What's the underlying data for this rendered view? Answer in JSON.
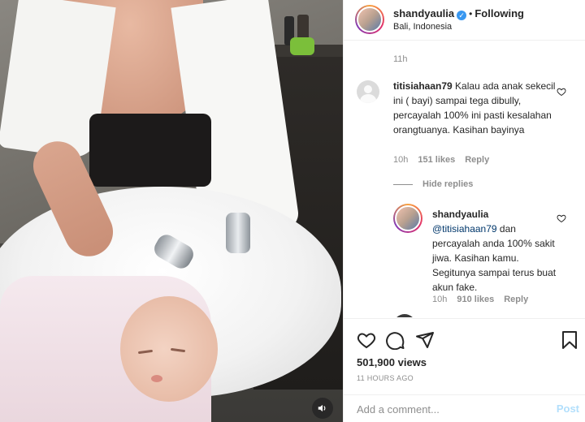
{
  "post": {
    "username": "shandyaulia",
    "verified_icon": "verified-badge-icon",
    "separator": "•",
    "follow_label": "Following",
    "location": "Bali, Indonesia",
    "top_timestamp": "11h"
  },
  "comments": [
    {
      "username": "titisiahaan79",
      "text": "Kalau ada anak sekecil ini ( bayi) sampai tega dibully, percayalah 100% ini pasti kesalahan orangtuanya. Kasihan bayinya",
      "time": "10h",
      "likes": "151 likes",
      "reply_label": "Reply",
      "hide_replies_label": "Hide replies"
    }
  ],
  "reply": {
    "username": "shandyaulia",
    "mention": "@titisiahaan79",
    "text": " dan percayalah anda 100% sakit jiwa. Kasihan kamu. Segitunya sampai terus buat akun fake.",
    "time": "10h",
    "likes": "910 likes",
    "reply_label": "Reply"
  },
  "actions": {
    "views": "501,900 views",
    "posted_ago": "11 HOURS AGO"
  },
  "composer": {
    "placeholder": "Add a comment...",
    "post_label": "Post"
  },
  "colors": {
    "verified": "#3897f0",
    "link": "#00376b",
    "muted": "#8e8e8e",
    "post_disabled": "#b2dffc"
  }
}
